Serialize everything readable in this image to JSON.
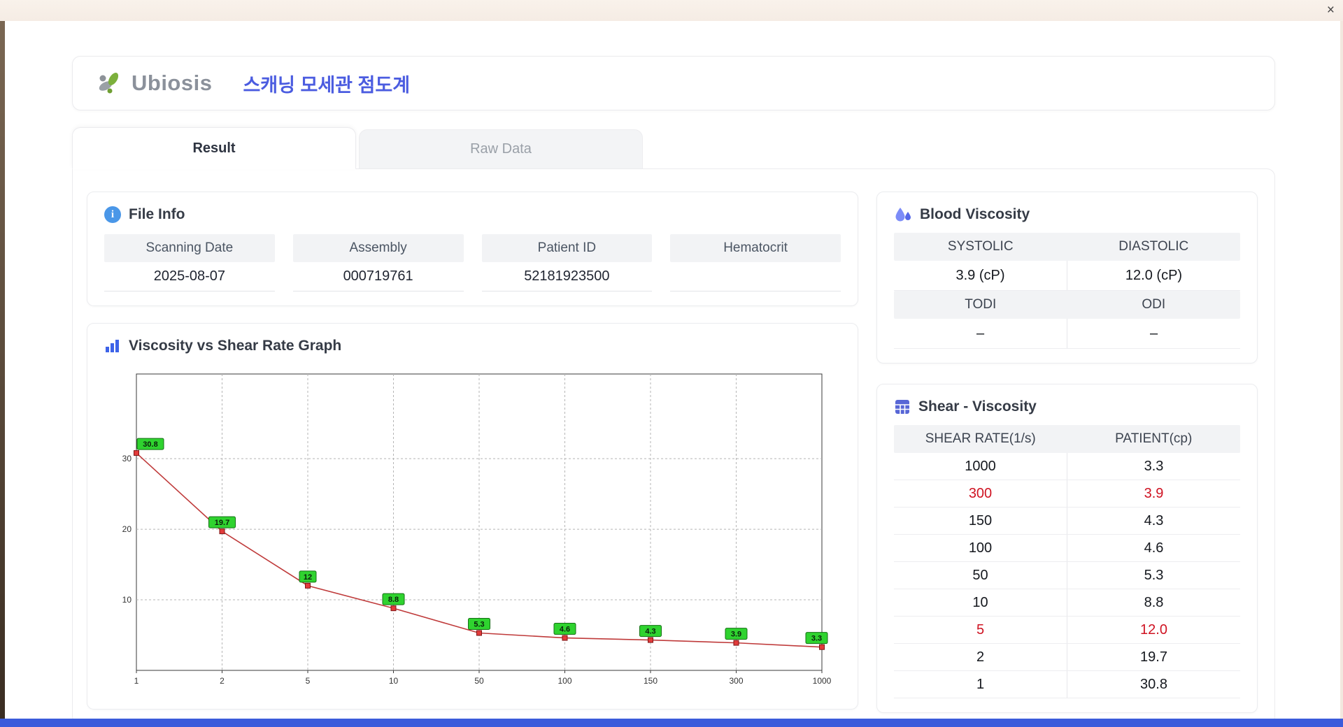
{
  "window": {
    "close_label": "×"
  },
  "header": {
    "logo_text": "Ubiosis",
    "title": "스캐닝 모세관 점도계"
  },
  "tabs": [
    {
      "label": "Result",
      "active": true
    },
    {
      "label": "Raw Data",
      "active": false
    }
  ],
  "file_info": {
    "title": "File Info",
    "fields": [
      {
        "label": "Scanning Date",
        "value": "2025-08-07"
      },
      {
        "label": "Assembly",
        "value": "000719761"
      },
      {
        "label": "Patient ID",
        "value": "52181923500"
      },
      {
        "label": "Hematocrit",
        "value": ""
      }
    ]
  },
  "graph": {
    "title": "Viscosity vs Shear Rate Graph"
  },
  "chart_data": {
    "type": "line",
    "title": "Viscosity vs Shear Rate Graph",
    "xlabel": "",
    "ylabel": "",
    "x": [
      1,
      2,
      5,
      10,
      50,
      100,
      150,
      300,
      1000
    ],
    "x_tick_labels": [
      "1",
      "2",
      "5",
      "10",
      "50",
      "100",
      "150",
      "300",
      "1000"
    ],
    "y": [
      30.8,
      19.7,
      12,
      8.8,
      5.3,
      4.6,
      4.3,
      3.9,
      3.3
    ],
    "point_labels": [
      "30.8",
      "19.7",
      "12",
      "8.8",
      "5.3",
      "4.6",
      "4.3",
      "3.9",
      "3.3"
    ],
    "y_ticks": [
      10,
      20,
      30
    ],
    "ylim": [
      0,
      42
    ],
    "x_scale": "categorical-even-spacing",
    "grid": "dashed",
    "legend": "none",
    "line_color": "#bf3a3a",
    "marker_color": "#e23b3b",
    "label_bg": "#2fd32f"
  },
  "blood_viscosity": {
    "title": "Blood Viscosity",
    "rows": [
      {
        "headers": [
          "SYSTOLIC",
          "DIASTOLIC"
        ],
        "values": [
          "3.9 (cP)",
          "12.0 (cP)"
        ]
      },
      {
        "headers": [
          "TODI",
          "ODI"
        ],
        "values": [
          "–",
          "–"
        ]
      }
    ]
  },
  "shear_viscosity": {
    "title": "Shear - Viscosity",
    "columns": [
      "SHEAR RATE(1/s)",
      "PATIENT(cp)"
    ],
    "rows": [
      {
        "shear_rate": "1000",
        "patient": "3.3",
        "highlight": false
      },
      {
        "shear_rate": "300",
        "patient": "3.9",
        "highlight": true
      },
      {
        "shear_rate": "150",
        "patient": "4.3",
        "highlight": false
      },
      {
        "shear_rate": "100",
        "patient": "4.6",
        "highlight": false
      },
      {
        "shear_rate": "50",
        "patient": "5.3",
        "highlight": false
      },
      {
        "shear_rate": "10",
        "patient": "8.8",
        "highlight": false
      },
      {
        "shear_rate": "5",
        "patient": "12.0",
        "highlight": true
      },
      {
        "shear_rate": "2",
        "patient": "19.7",
        "highlight": false
      },
      {
        "shear_rate": "1",
        "patient": "30.8",
        "highlight": false
      }
    ]
  },
  "colors": {
    "accent_blue_title": "#4b5ce0",
    "alert_red": "#cf1322",
    "chart_line_red": "#bf3a3a",
    "chart_label_green": "#2fd32f",
    "bottom_bar_blue": "#3b5bdb",
    "header_cell_gray": "#f2f3f5"
  }
}
